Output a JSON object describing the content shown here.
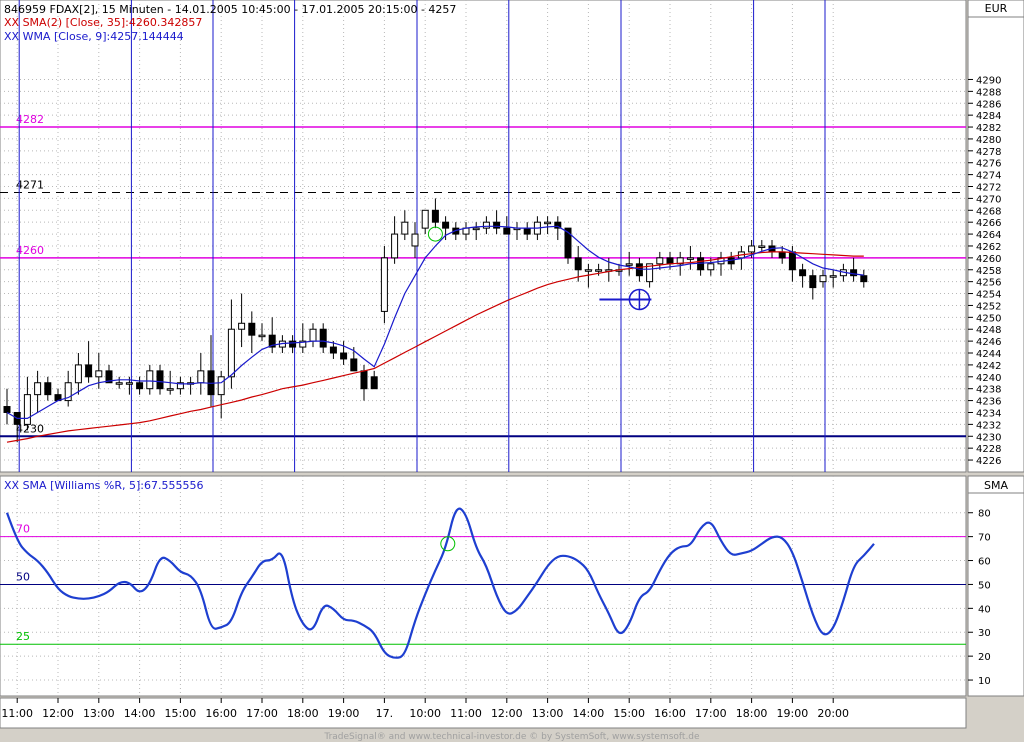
{
  "header": {
    "line1": "846959  FDAX[2], 15 Minuten - 14.01.2005 10:45:00 - 17.01.2005 20:15:00 - 4257",
    "line2": "XX SMA(2) [Close, 35]:4260.342857",
    "line3": "XX WMA [Close, 9]:4257.144444",
    "currency": "EUR"
  },
  "indicator_header": "XX SMA [Williams %R, 5]:67.555556",
  "indicator_axis_label": "SMA",
  "footer": "TradeSignal® and www.technical-investor.de © by  SystemSoft, www.systemsoft.de",
  "colors": {
    "plot_bg": "#ffffff",
    "frame_bg": "#d4d0c8",
    "magenta": "#e000e0",
    "blue": "#1a1acc",
    "navy": "#000080",
    "red": "#cc0000",
    "green": "#00c000",
    "line_blue": "#1e3fd0"
  },
  "chart_data": [
    {
      "type": "candlestick",
      "title": "846959  FDAX[2], 15 Minuten - 14.01.2005 10:45:00 - 17.01.2005 20:15:00 - 4257",
      "ylim": [
        4225,
        4300
      ],
      "y_ticks": [
        4226,
        4228,
        4230,
        4232,
        4234,
        4236,
        4238,
        4240,
        4242,
        4244,
        4246,
        4248,
        4250,
        4252,
        4254,
        4256,
        4258,
        4260,
        4262,
        4264,
        4266,
        4268,
        4270,
        4272,
        4274,
        4276,
        4278,
        4280,
        4282,
        4284,
        4286,
        4288,
        4290
      ],
      "x_tick_labels": [
        "11:00",
        "12:00",
        "13:00",
        "14:00",
        "15:00",
        "16:00",
        "17:00",
        "18:00",
        "19:00",
        "17.",
        "10:00",
        "11:00",
        "12:00",
        "13:00",
        "14:00",
        "15:00",
        "16:00",
        "17:00",
        "18:00",
        "19:00",
        "20:00"
      ],
      "x_tick_index": [
        1,
        5,
        9,
        13,
        17,
        21,
        25,
        29,
        33,
        37,
        41,
        45,
        49,
        53,
        57,
        61,
        65,
        69,
        73,
        77,
        81
      ],
      "candles": [
        [
          4235,
          4238,
          4232,
          4234
        ],
        [
          4234,
          4234,
          4229,
          4232
        ],
        [
          4232,
          4240,
          4231,
          4237
        ],
        [
          4237,
          4241,
          4234,
          4239
        ],
        [
          4239,
          4240,
          4236,
          4237
        ],
        [
          4237,
          4238,
          4236,
          4236
        ],
        [
          4236,
          4241,
          4235,
          4239
        ],
        [
          4239,
          4244,
          4237,
          4242
        ],
        [
          4242,
          4246,
          4239,
          4240
        ],
        [
          4240,
          4244,
          4238,
          4241
        ],
        [
          4241,
          4242,
          4239,
          4239
        ],
        [
          4239,
          4240,
          4238,
          4239
        ],
        [
          4239,
          4240,
          4237,
          4239
        ],
        [
          4239,
          4240,
          4237,
          4238
        ],
        [
          4238,
          4242,
          4237,
          4241
        ],
        [
          4241,
          4242,
          4237,
          4238
        ],
        [
          4238,
          4241,
          4237,
          4238
        ],
        [
          4238,
          4240,
          4237,
          4239
        ],
        [
          4239,
          4240,
          4237,
          4239
        ],
        [
          4239,
          4244,
          4237,
          4241
        ],
        [
          4241,
          4247,
          4235,
          4237
        ],
        [
          4237,
          4241,
          4233,
          4240
        ],
        [
          4240,
          4253,
          4238,
          4248
        ],
        [
          4248,
          4254,
          4245,
          4249
        ],
        [
          4249,
          4251,
          4244,
          4247
        ],
        [
          4247,
          4249,
          4246,
          4247
        ],
        [
          4247,
          4250,
          4244,
          4245
        ],
        [
          4245,
          4247,
          4244,
          4246
        ],
        [
          4246,
          4247,
          4244,
          4245
        ],
        [
          4245,
          4249,
          4244,
          4246
        ],
        [
          4246,
          4249,
          4245,
          4248
        ],
        [
          4248,
          4249,
          4244,
          4245
        ],
        [
          4245,
          4246,
          4243,
          4244
        ],
        [
          4244,
          4246,
          4242,
          4243
        ],
        [
          4243,
          4245,
          4241,
          4241
        ],
        [
          4241,
          4242,
          4236,
          4238
        ],
        [
          4240,
          4241,
          4238,
          4238
        ],
        [
          4251,
          4262,
          4249,
          4260
        ],
        [
          4260,
          4267,
          4259,
          4264
        ],
        [
          4264,
          4268,
          4263,
          4266
        ],
        [
          4262,
          4266,
          4260,
          4264
        ],
        [
          4265,
          4268,
          4264,
          4268
        ],
        [
          4268,
          4270,
          4265,
          4266
        ],
        [
          4266,
          4267,
          4263,
          4265
        ],
        [
          4265,
          4266,
          4263,
          4264
        ],
        [
          4264,
          4266,
          4263,
          4265
        ],
        [
          4265,
          4266,
          4263,
          4265
        ],
        [
          4265,
          4267,
          4264,
          4266
        ],
        [
          4266,
          4268,
          4264,
          4265
        ],
        [
          4265,
          4267,
          4264,
          4264
        ],
        [
          4265,
          4266,
          4263,
          4265
        ],
        [
          4265,
          4266,
          4263,
          4264
        ],
        [
          4264,
          4267,
          4263,
          4266
        ],
        [
          4266,
          4267,
          4264,
          4266
        ],
        [
          4266,
          4267,
          4263,
          4265
        ],
        [
          4265,
          4265,
          4259,
          4260
        ],
        [
          4260,
          4262,
          4256,
          4258
        ],
        [
          4258,
          4259,
          4255,
          4258
        ],
        [
          4258,
          4259,
          4257,
          4258
        ],
        [
          4258,
          4260,
          4256,
          4258
        ],
        [
          4258,
          4259,
          4257,
          4258
        ],
        [
          4259,
          4261,
          4257,
          4259
        ],
        [
          4259,
          4260,
          4256,
          4257
        ],
        [
          4256,
          4259,
          4255,
          4259
        ],
        [
          4259,
          4261,
          4258,
          4260
        ],
        [
          4260,
          4261,
          4258,
          4259
        ],
        [
          4259,
          4261,
          4257,
          4260
        ],
        [
          4260,
          4262,
          4258,
          4260
        ],
        [
          4260,
          4261,
          4257,
          4258
        ],
        [
          4258,
          4260,
          4257,
          4259
        ],
        [
          4259,
          4261,
          4257,
          4260
        ],
        [
          4260,
          4261,
          4258,
          4259
        ],
        [
          4260,
          4262,
          4258,
          4261
        ],
        [
          4261,
          4263,
          4260,
          4262
        ],
        [
          4262,
          4263,
          4261,
          4262
        ],
        [
          4262,
          4263,
          4260,
          4261
        ],
        [
          4261,
          4262,
          4259,
          4260
        ],
        [
          4261,
          4262,
          4256,
          4258
        ],
        [
          4258,
          4259,
          4255,
          4257
        ],
        [
          4257,
          4258,
          4253,
          4255
        ],
        [
          4256,
          4258,
          4255,
          4257
        ],
        [
          4257,
          4258,
          4255,
          4257
        ],
        [
          4257,
          4259,
          4256,
          4258
        ],
        [
          4258,
          4260,
          4256,
          4257
        ],
        [
          4257,
          4258,
          4255,
          4256
        ]
      ],
      "series": [
        {
          "name": "XX SMA(2) [Close, 35]",
          "values": [
            4229,
            4229.3,
            4229.6,
            4230,
            4230.3,
            4230.6,
            4230.9,
            4231.1,
            4231.3,
            4231.5,
            4231.7,
            4231.9,
            4232.1,
            4232.3,
            4232.6,
            4233,
            4233.4,
            4233.8,
            4234.2,
            4234.5,
            4234.9,
            4235.3,
            4235.7,
            4236.1,
            4236.6,
            4237,
            4237.5,
            4238,
            4238.3,
            4238.6,
            4239,
            4239.4,
            4239.8,
            4240.2,
            4240.6,
            4241,
            4241.4,
            4242.3,
            4243.2,
            4244.1,
            4245,
            4245.9,
            4246.8,
            4247.7,
            4248.6,
            4249.5,
            4250.4,
            4251.2,
            4252,
            4252.8,
            4253.5,
            4254.2,
            4254.9,
            4255.5,
            4256,
            4256.4,
            4256.8,
            4257.1,
            4257.4,
            4257.7,
            4258,
            4258.2,
            4258.4,
            4258.6,
            4258.8,
            4259,
            4259.1,
            4259.2,
            4259.4,
            4259.6,
            4259.9,
            4260.2,
            4260.5,
            4260.7,
            4260.9,
            4261,
            4261,
            4260.9,
            4260.8,
            4260.7,
            4260.6,
            4260.5,
            4260.4,
            4260.3,
            4260.3
          ]
        },
        {
          "name": "XX WMA [Close, 9]",
          "values": [
            4234,
            4233,
            4233,
            4234,
            4235,
            4236,
            4236.5,
            4237.5,
            4238.5,
            4239,
            4239.3,
            4239.5,
            4239.5,
            4239.3,
            4239.3,
            4239.2,
            4239,
            4238.8,
            4238.8,
            4239,
            4238.9,
            4239,
            4240.3,
            4241.9,
            4243.3,
            4244.6,
            4245.3,
            4245.6,
            4245.7,
            4245.8,
            4246,
            4246,
            4245.7,
            4245.2,
            4244.4,
            4243,
            4241.7,
            4245.5,
            4249.9,
            4254,
            4257,
            4260,
            4262,
            4263.8,
            4264.6,
            4265,
            4265.2,
            4265.3,
            4265.3,
            4265.2,
            4265,
            4265,
            4265,
            4265.2,
            4265.3,
            4264.3,
            4262.8,
            4261.3,
            4260.1,
            4259.3,
            4258.8,
            4258.5,
            4258.1,
            4258.1,
            4258.3,
            4258.5,
            4258.7,
            4259,
            4259.1,
            4259.2,
            4259.4,
            4259.6,
            4259.9,
            4260.5,
            4261.1,
            4261.6,
            4261.7,
            4261,
            4260,
            4259,
            4258.3,
            4258,
            4257.6,
            4257.3,
            4257.1
          ]
        }
      ],
      "horizontal_levels": [
        {
          "label": "4282",
          "value": 4282,
          "style": "magenta"
        },
        {
          "label": "4271",
          "value": 4271,
          "style": "dashed"
        },
        {
          "label": "4260",
          "value": 4260,
          "style": "magenta"
        },
        {
          "label": "4230",
          "value": 4230,
          "style": "navy"
        }
      ],
      "vertical_markers_index": [
        1,
        12,
        20,
        28,
        40,
        49,
        60,
        73,
        80
      ],
      "circle_markers": [
        {
          "index": 42,
          "value": 4264,
          "color": "green"
        }
      ],
      "target_marker": {
        "index": 62,
        "value": 4253
      }
    },
    {
      "type": "line",
      "title": "XX SMA [Williams %R, 5]:67.555556",
      "ylim": [
        5,
        87
      ],
      "y_ticks": [
        10,
        20,
        30,
        40,
        50,
        60,
        70,
        80
      ],
      "levels": [
        {
          "label": "70",
          "value": 70,
          "color": "magenta"
        },
        {
          "label": "50",
          "value": 50,
          "color": "navy"
        },
        {
          "label": "25",
          "value": 25,
          "color": "green"
        }
      ],
      "series": [
        {
          "name": "XX SMA [Williams %R, 5]",
          "values": [
            80,
            68,
            63,
            60,
            55,
            48,
            45,
            44,
            44,
            45,
            47,
            51,
            51,
            46,
            50,
            62,
            60,
            55,
            54,
            48,
            31,
            32,
            34,
            47,
            53,
            60,
            60,
            65,
            43,
            33,
            30,
            42,
            40,
            35,
            35,
            33,
            30,
            21,
            19,
            20,
            35,
            46,
            56,
            65,
            83,
            80,
            65,
            58,
            45,
            37,
            39,
            45,
            51,
            58,
            62,
            62,
            60,
            56,
            46,
            38,
            28,
            33,
            45,
            47,
            56,
            63,
            66,
            66,
            74,
            77,
            68,
            62,
            63,
            64,
            67,
            70,
            70,
            64,
            51,
            37,
            28,
            31,
            43,
            58,
            62,
            67
          ]
        },
        {
          "name": "circle",
          "values": []
        }
      ],
      "circle_markers": [
        {
          "index": 44,
          "value": 67,
          "color": "green"
        }
      ]
    }
  ]
}
